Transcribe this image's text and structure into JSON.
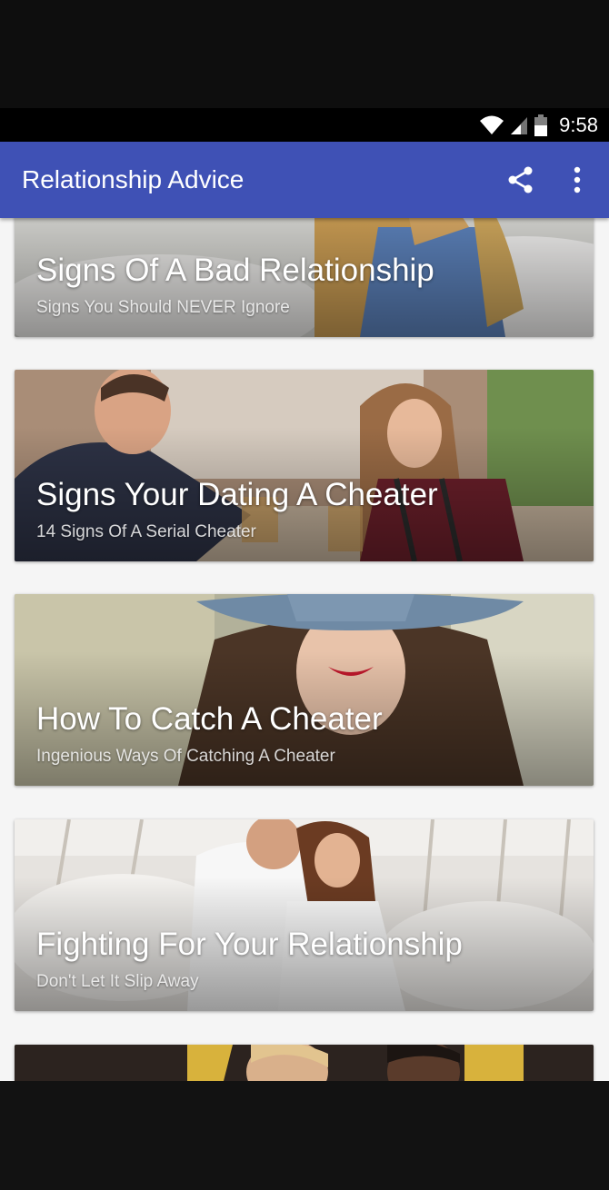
{
  "status_bar": {
    "time": "9:58",
    "icons": [
      "wifi-icon",
      "signal-icon",
      "battery-icon"
    ]
  },
  "app_bar": {
    "title": "Relationship Advice",
    "actions": [
      "share-icon",
      "more-vert-icon"
    ],
    "color": "#3f51b5"
  },
  "cards": [
    {
      "title": "Signs Of A Bad Relationship",
      "subtitle": "Signs You Should NEVER Ignore"
    },
    {
      "title": "Signs Your Dating A Cheater",
      "subtitle": "14 Signs Of A Serial Cheater"
    },
    {
      "title": "How To Catch A Cheater",
      "subtitle": "Ingenious Ways Of Catching A Cheater"
    },
    {
      "title": "Fighting For Your Relationship",
      "subtitle": "Don't Let It Slip Away"
    },
    {
      "title": "",
      "subtitle": ""
    }
  ]
}
